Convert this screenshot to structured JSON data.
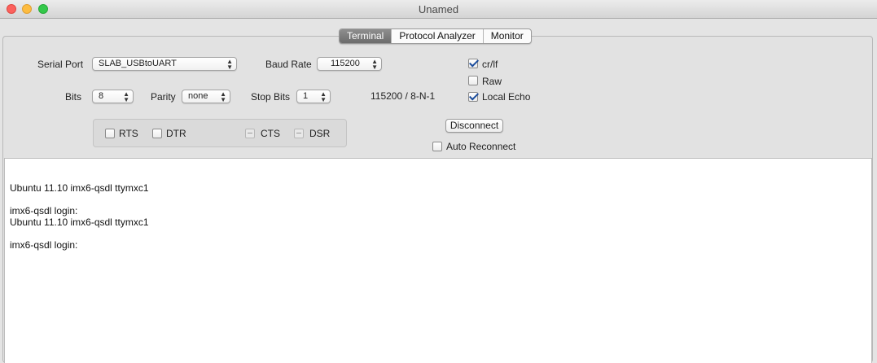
{
  "window": {
    "title": "Unamed"
  },
  "tabs": [
    {
      "label": "Terminal",
      "active": true
    },
    {
      "label": "Protocol Analyzer",
      "active": false
    },
    {
      "label": "Monitor",
      "active": false
    }
  ],
  "settings": {
    "serial_port_label": "Serial Port",
    "serial_port_value": "SLAB_USBtoUART",
    "baud_rate_label": "Baud Rate",
    "baud_rate_value": "115200",
    "bits_label": "Bits",
    "bits_value": "8",
    "parity_label": "Parity",
    "parity_value": "none",
    "stop_bits_label": "Stop Bits",
    "stop_bits_value": "1",
    "summary": "115200 / 8-N-1"
  },
  "options": {
    "crlf": {
      "label": "cr/lf",
      "checked": true
    },
    "raw": {
      "label": "Raw",
      "checked": false
    },
    "local_echo": {
      "label": "Local Echo",
      "checked": true
    }
  },
  "signals": {
    "rts": "RTS",
    "dtr": "DTR",
    "cts": "CTS",
    "dsr": "DSR"
  },
  "connection": {
    "button_label": "Disconnect",
    "auto_reconnect_label": "Auto Reconnect",
    "auto_reconnect_checked": false
  },
  "terminal": {
    "lines": [
      "Ubuntu 11.10 imx6-qsdl ttymxc1",
      "imx6-qsdl login:",
      "Ubuntu 11.10 imx6-qsdl ttymxc1",
      "imx6-qsdl login:"
    ]
  }
}
